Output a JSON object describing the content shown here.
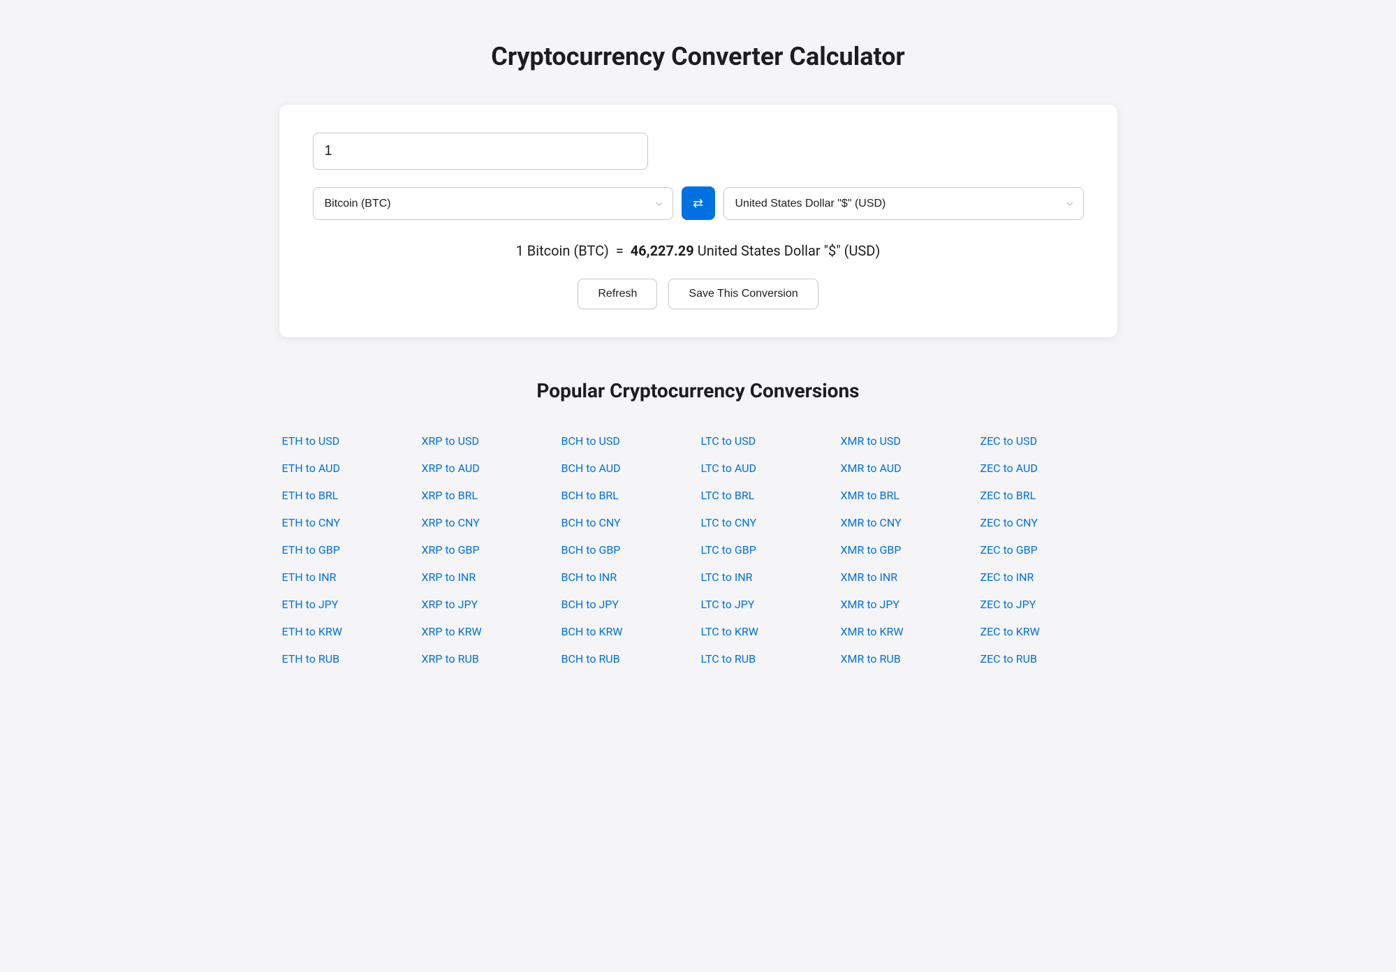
{
  "page": {
    "title": "Cryptocurrency Converter Calculator"
  },
  "converter": {
    "amount_value": "1",
    "from_currency": "Bitcoin (BTC)",
    "to_currency": "United States Dollar \"$\" (USD)",
    "result_text_prefix": "1 Bitcoin (BTC)",
    "result_equals": "=",
    "result_amount": "46,227.29",
    "result_currency": "United States Dollar \"$\" (USD)",
    "refresh_label": "Refresh",
    "save_label": "Save This Conversion",
    "swap_icon": "⇄"
  },
  "popular": {
    "title": "Popular Cryptocurrency Conversions",
    "columns": [
      {
        "items": [
          "ETH to USD",
          "ETH to AUD",
          "ETH to BRL",
          "ETH to CNY",
          "ETH to GBP",
          "ETH to INR",
          "ETH to JPY",
          "ETH to KRW",
          "ETH to RUB"
        ]
      },
      {
        "items": [
          "XRP to USD",
          "XRP to AUD",
          "XRP to BRL",
          "XRP to CNY",
          "XRP to GBP",
          "XRP to INR",
          "XRP to JPY",
          "XRP to KRW",
          "XRP to RUB"
        ]
      },
      {
        "items": [
          "BCH to USD",
          "BCH to AUD",
          "BCH to BRL",
          "BCH to CNY",
          "BCH to GBP",
          "BCH to INR",
          "BCH to JPY",
          "BCH to KRW",
          "BCH to RUB"
        ]
      },
      {
        "items": [
          "LTC to USD",
          "LTC to AUD",
          "LTC to BRL",
          "LTC to CNY",
          "LTC to GBP",
          "LTC to INR",
          "LTC to JPY",
          "LTC to KRW",
          "LTC to RUB"
        ]
      },
      {
        "items": [
          "XMR to USD",
          "XMR to AUD",
          "XMR to BRL",
          "XMR to CNY",
          "XMR to GBP",
          "XMR to INR",
          "XMR to JPY",
          "XMR to KRW",
          "XMR to RUB"
        ]
      },
      {
        "items": [
          "ZEC to USD",
          "ZEC to AUD",
          "ZEC to BRL",
          "ZEC to CNY",
          "ZEC to GBP",
          "ZEC to INR",
          "ZEC to JPY",
          "ZEC to KRW",
          "ZEC to RUB"
        ]
      }
    ]
  }
}
